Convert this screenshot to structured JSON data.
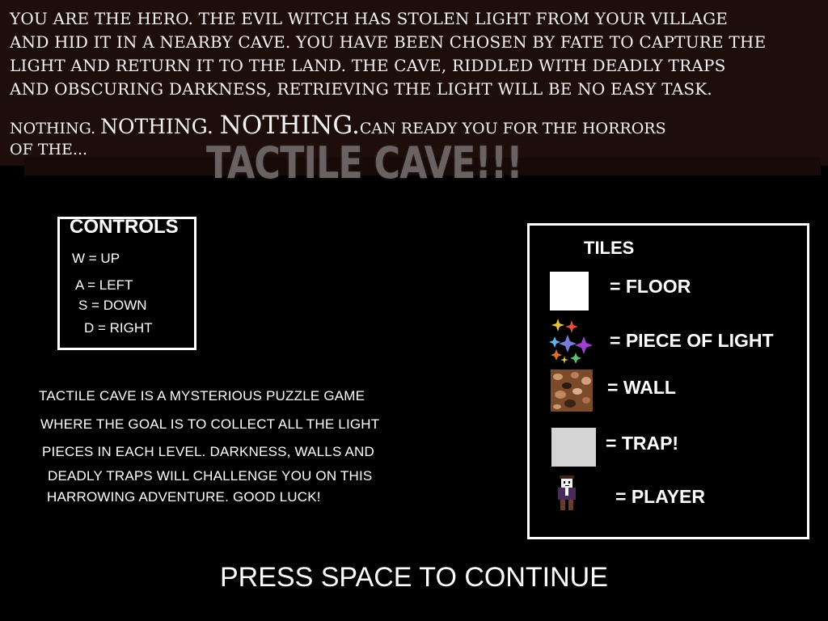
{
  "story": {
    "lines": [
      "You are the hero. The evil witch has stolen light from your village",
      "and hid it in a nearby cave. You have been chosen by fate to capture the",
      "light and return it to the land. The cave, riddled with deadly traps",
      "and obscuring darkness, retrieving the light will be no easy task."
    ],
    "nothing_1": "Nothing. ",
    "nothing_2": "Nothing. ",
    "nothing_3": "Nothing.",
    "nothing_rest": "can ready you for the horrors",
    "nothing_line2": "of the..."
  },
  "title": "TACTILE CAVE!!!",
  "controls": {
    "title": "CONTROLS",
    "items": [
      "W = UP",
      "A = LEFT",
      "S = DOWN",
      "D = RIGHT"
    ]
  },
  "description": [
    "TACTILE CAVE IS A MYSTERIOUS PUZZLE GAME",
    "WHERE THE GOAL IS TO COLLECT ALL THE LIGHT",
    "PIECES IN EACH LEVEL. DARKNESS, WALLS AND",
    "DEADLY TRAPS WILL CHALLENGE YOU ON THIS",
    "HARROWING ADVENTURE. GOOD LUCK!"
  ],
  "tiles": {
    "title": "TILES",
    "floor": "= FLOOR",
    "light": "= PIECE OF LIGHT",
    "wall": "= WALL",
    "trap": "= TRAP!",
    "player": "= PLAYER"
  },
  "prompt": "PRESS SPACE TO CONTINUE",
  "colors": {
    "background": "#000000",
    "story_band": "#1e0e0b",
    "title": "#6a6262",
    "floor": "#ffffff",
    "trap": "#d4d4d4",
    "wall": "#7a4a2a"
  }
}
